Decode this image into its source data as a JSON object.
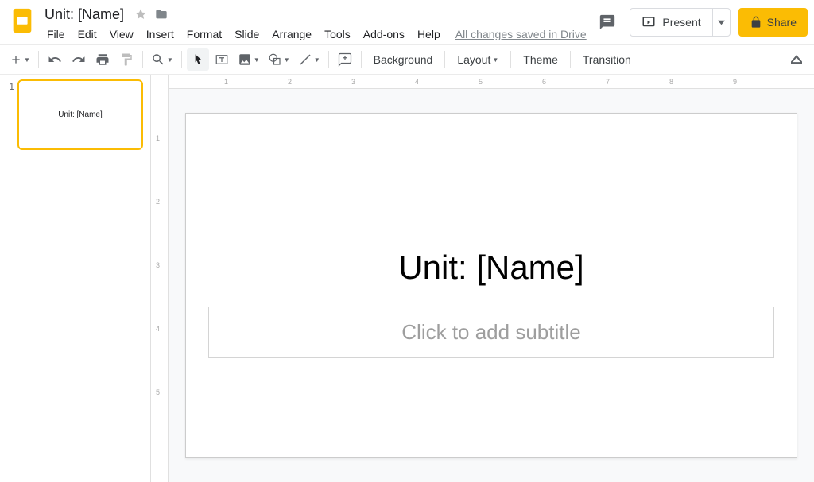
{
  "header": {
    "doc_title": "Unit: [Name]",
    "menus": [
      "File",
      "Edit",
      "View",
      "Insert",
      "Format",
      "Slide",
      "Arrange",
      "Tools",
      "Add-ons",
      "Help"
    ],
    "save_status": "All changes saved in Drive",
    "present_label": "Present",
    "share_label": "Share"
  },
  "toolbar": {
    "background_label": "Background",
    "layout_label": "Layout",
    "theme_label": "Theme",
    "transition_label": "Transition"
  },
  "filmstrip": {
    "slides": [
      {
        "number": "1",
        "thumb_title": "Unit: [Name]"
      }
    ]
  },
  "ruler": {
    "h_numbers": [
      "1",
      "2",
      "3",
      "4",
      "5",
      "6",
      "7",
      "8",
      "9"
    ],
    "v_numbers": [
      "1",
      "2",
      "3",
      "4",
      "5"
    ]
  },
  "slide_content": {
    "title": "Unit: [Name]",
    "subtitle_placeholder": "Click to add subtitle"
  }
}
